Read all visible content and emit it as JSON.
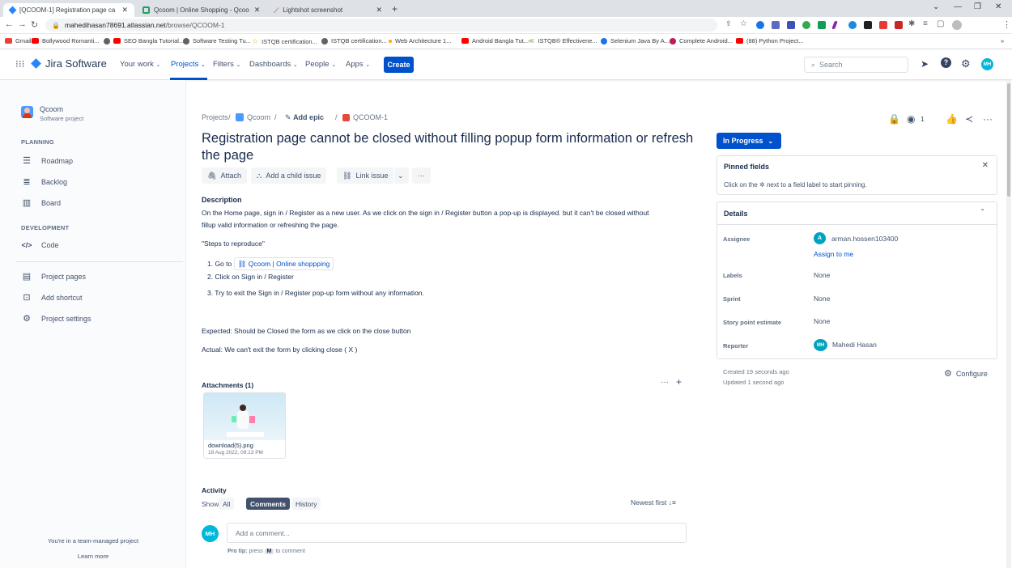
{
  "browser": {
    "tabs": [
      {
        "title": "[QCOOM-1] Registration page ca",
        "active": true
      },
      {
        "title": "Qcoom | Online Shopping - Qcoo",
        "active": false
      },
      {
        "title": "Lightshot screenshot",
        "active": false
      }
    ],
    "url_host": "mahedihasan78691.atlassian.net",
    "url_path": "/browse/QCOOM-1",
    "bookmarks": [
      {
        "label": "Gmail",
        "color": "#ea4335"
      },
      {
        "label": "Bollywood Romanti...",
        "color": "#ff0000"
      },
      {
        "label": "SEO Bangla Tutorial...",
        "color": "#ff0000"
      },
      {
        "label": "Software Testing Tu...",
        "color": "#5f6368"
      },
      {
        "label": "ISTQB certification...",
        "color": "#f9ab00"
      },
      {
        "label": "ISTQB certification...",
        "color": "#5f6368"
      },
      {
        "label": "Web Architecture 1...",
        "color": "#f9ab00"
      },
      {
        "label": "Android Bangla Tut...",
        "color": "#ff0000"
      },
      {
        "label": "ISTQB® Effectivene...",
        "color": "#7cb342"
      },
      {
        "label": "Selenium Java By A...",
        "color": "#1a73e8"
      },
      {
        "label": "Complete Android...",
        "color": "#c2185b"
      },
      {
        "label": "(88) Python Project...",
        "color": "#ff0000"
      }
    ]
  },
  "jira_nav": {
    "product": "Jira Software",
    "items": [
      "Your work",
      "Projects",
      "Filters",
      "Dashboards",
      "People",
      "Apps"
    ],
    "create": "Create",
    "search_placeholder": "Search",
    "avatar": "MH"
  },
  "sidebar": {
    "project_name": "Qcoom",
    "project_type": "Software project",
    "planning_heading": "PLANNING",
    "planning_items": [
      "Roadmap",
      "Backlog",
      "Board"
    ],
    "development_heading": "DEVELOPMENT",
    "development_items": [
      "Code"
    ],
    "other_items": [
      "Project pages",
      "Add shortcut",
      "Project settings"
    ],
    "footer_text": "You're in a team-managed project",
    "footer_link": "Learn more"
  },
  "breadcrumb": {
    "projects": "Projects",
    "project": "Qcoom",
    "epic": "Add epic",
    "issue": "QCOOM-1"
  },
  "issue": {
    "title": "Registration page cannot be closed without filling popup form information or refresh the page",
    "toolbar": {
      "attach": "Attach",
      "child": "Add a child issue",
      "link": "Link issue"
    },
    "description_heading": "Description",
    "description_line1": "On the Home page, sign in / Register as a new user. As we click on the sign in / Register button a pop-up is displayed. but it can't be closed without",
    "description_line2": "fillup valid information or refreshing the page.",
    "steps_heading": "\"Steps to reproduce\"",
    "step1_prefix": "1. Go to",
    "step1_link": "Qcoom | Online shoppping",
    "step2": "2. Click on Sign in / Register",
    "step3": "3. Try to exit the Sign in / Register pop-up form without any information.",
    "expected": "Expected: Should be Closed the form as we click on the close button",
    "actual": "Actual: We can't exit the form by clicking close ( X )",
    "attachments_heading": "Attachments (1)",
    "attachment_name": "download(5).png",
    "attachment_date": "18 Aug 2022, 09:13 PM",
    "watchers": "1"
  },
  "activity": {
    "heading": "Activity",
    "show_label": "Show:",
    "filters": [
      "All",
      "Comments",
      "History"
    ],
    "sort": "Newest first",
    "comment_placeholder": "Add a comment...",
    "pro_tip_prefix": "Pro tip:",
    "pro_tip_key": "M",
    "pro_tip_suffix": "to comment",
    "avatar": "MH"
  },
  "details": {
    "status": "In Progress",
    "pinned_heading": "Pinned fields",
    "pinned_hint": "Click on the ✲ next to a field label to start pinning.",
    "details_heading": "Details",
    "assignee_label": "Assignee",
    "assignee_value": "arman.hossen103400",
    "assignee_avatar": "A",
    "assign_to_me": "Assign to me",
    "labels_label": "Labels",
    "labels_value": "None",
    "sprint_label": "Sprint",
    "sprint_value": "None",
    "story_label": "Story point estimate",
    "story_value": "None",
    "reporter_label": "Reporter",
    "reporter_value": "Mahedi Hasan",
    "reporter_avatar": "MH",
    "created": "Created 19 seconds ago",
    "updated": "Updated 1 second ago",
    "configure": "Configure"
  }
}
